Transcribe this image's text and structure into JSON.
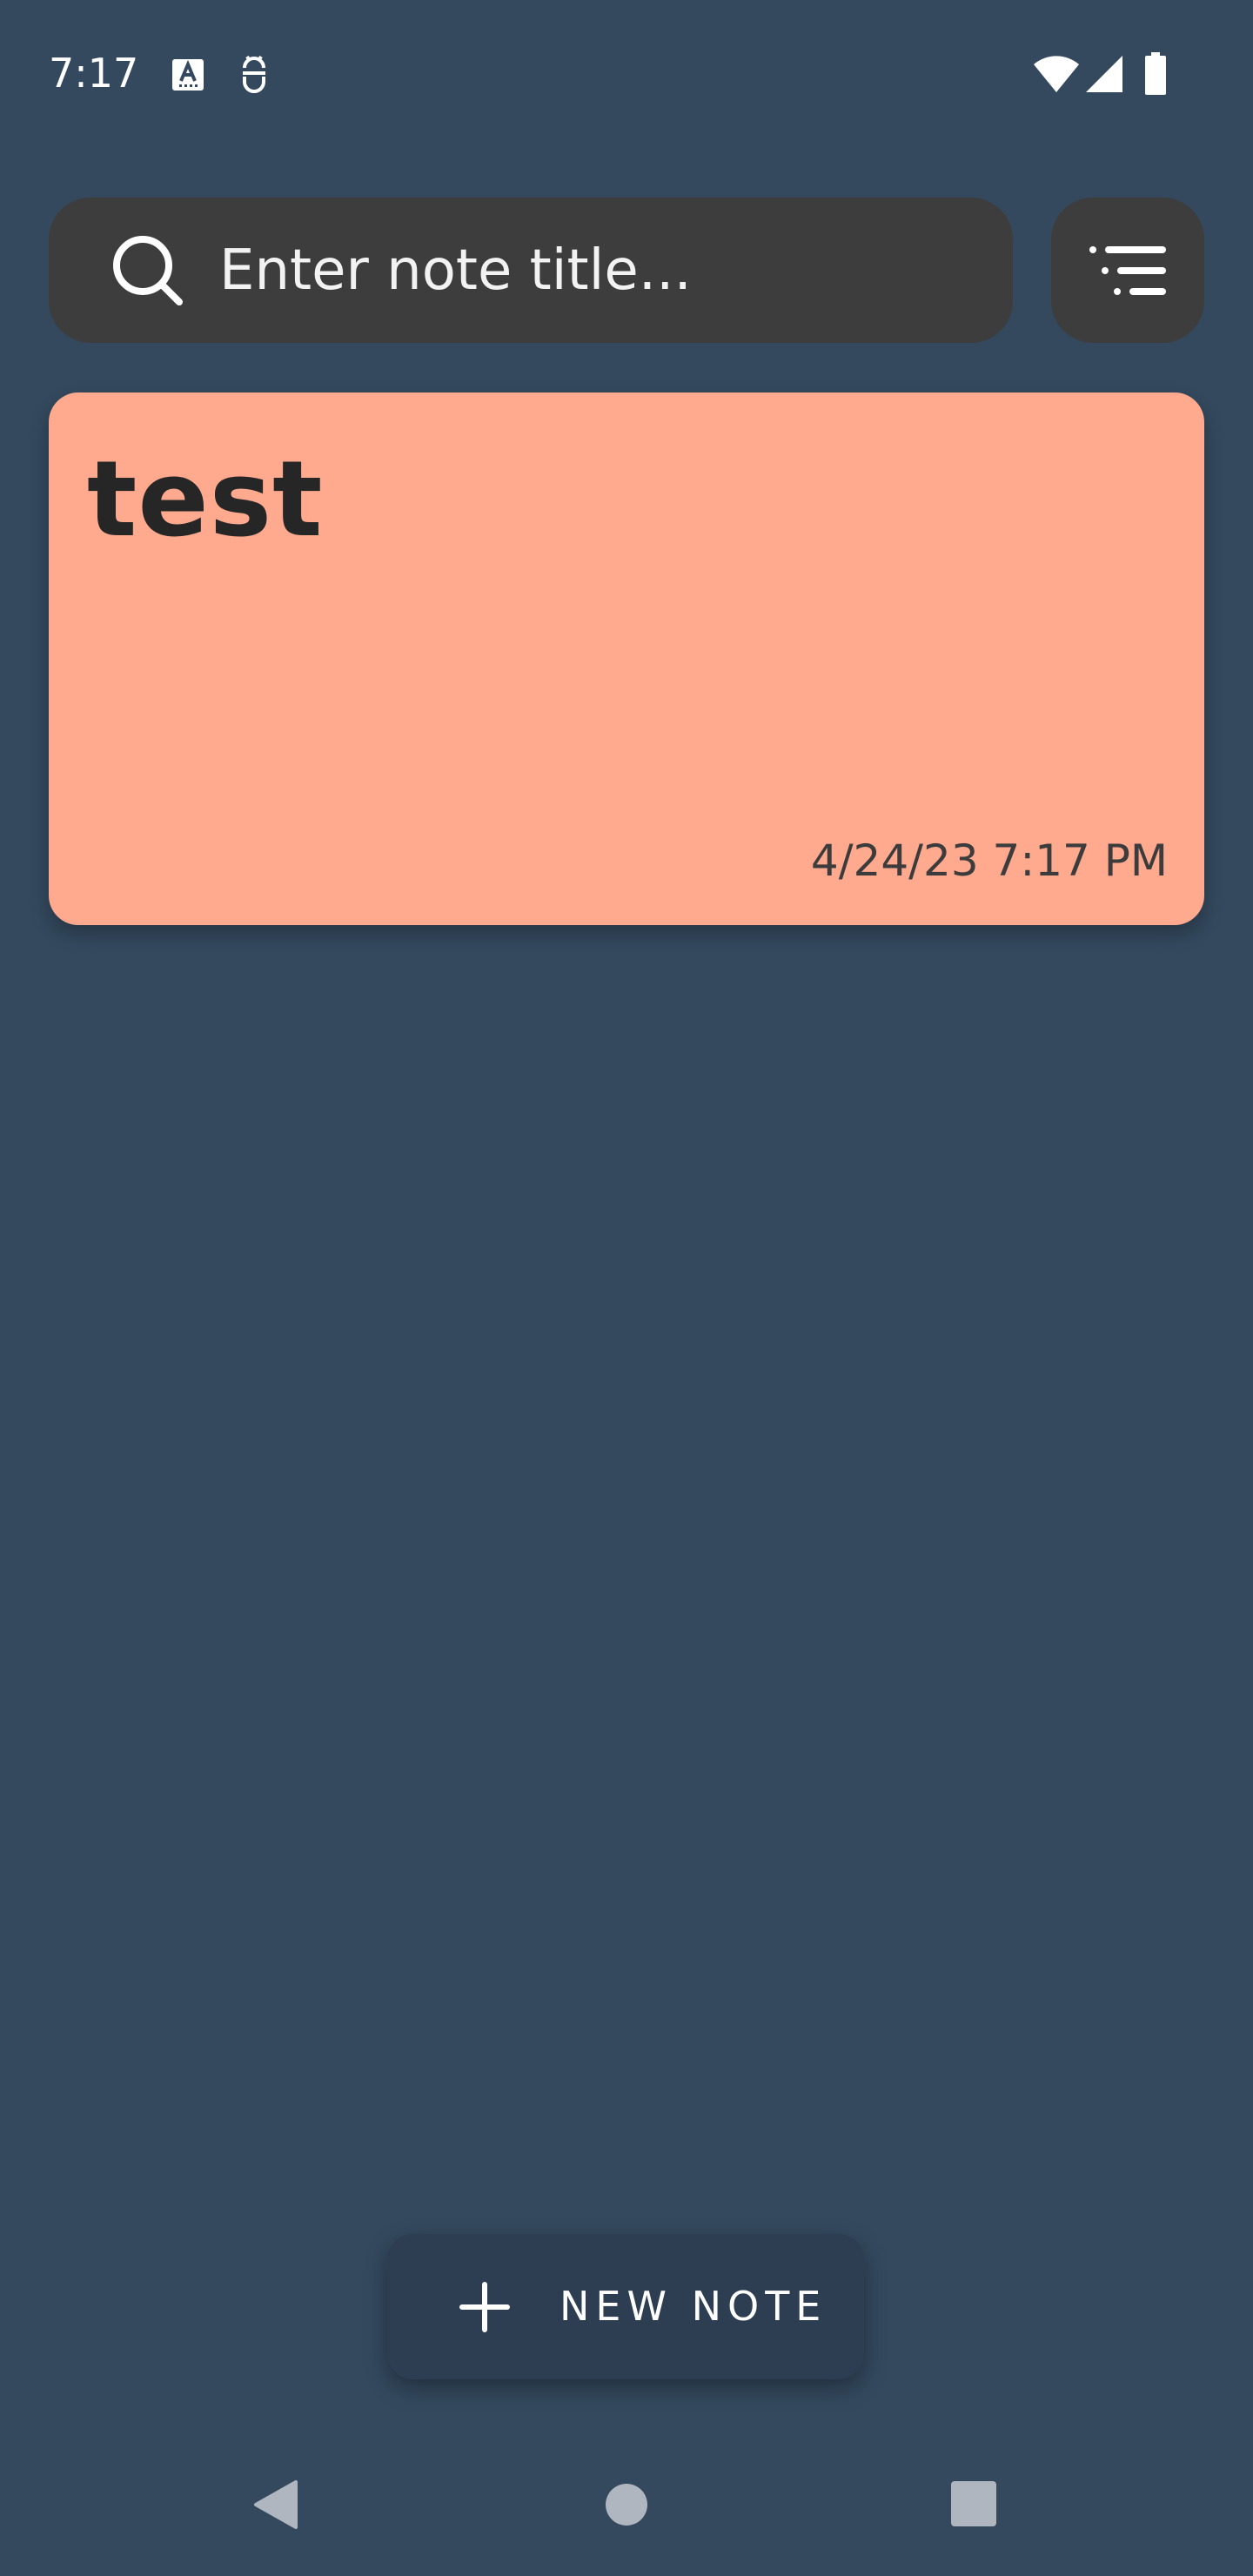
{
  "status_bar": {
    "time": "7:17",
    "icons": [
      "keyboard-a-icon",
      "debug-bot-icon",
      "wifi-icon",
      "cellular-signal-icon",
      "battery-icon"
    ]
  },
  "search": {
    "placeholder": "Enter note title...",
    "value": "",
    "icon": "search-icon"
  },
  "filter": {
    "icon": "sort-filter-icon"
  },
  "notes": [
    {
      "title": "test",
      "date": "4/24/23 7:17 PM",
      "color": "#ffa98f"
    }
  ],
  "fab": {
    "label": "NEW NOTE",
    "icon": "plus-icon"
  },
  "nav": {
    "back_icon": "back-triangle-icon",
    "home_icon": "home-circle-icon",
    "recents_icon": "recents-square-icon"
  },
  "colors": {
    "background": "#34495e",
    "search_bg": "#3d3d3d",
    "fab_bg": "#2d3e52",
    "note_color": "#ffa98f"
  }
}
